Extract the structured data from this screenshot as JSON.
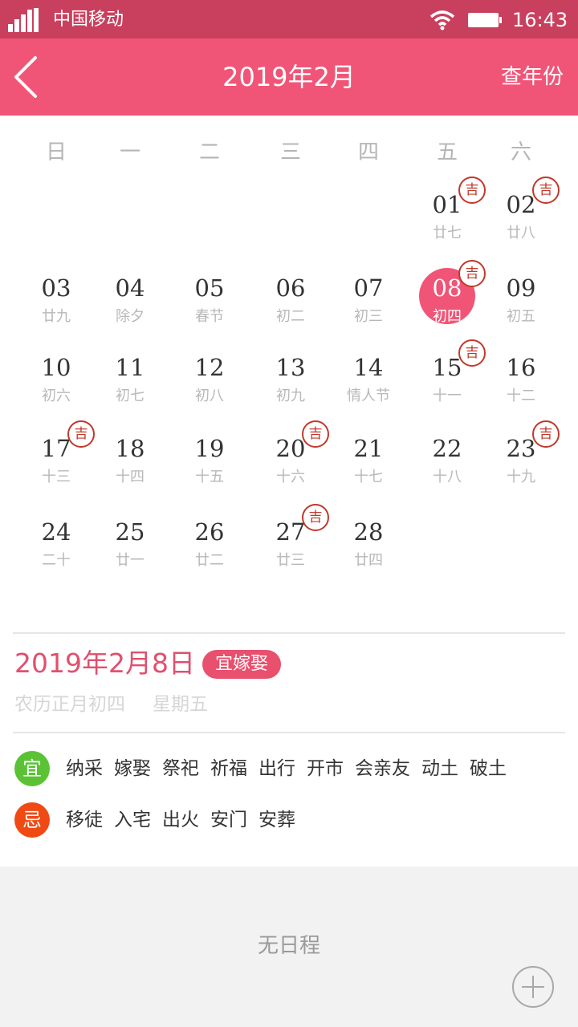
{
  "status_bar": {
    "carrier": "中国移动",
    "time": "16:43",
    "signal_icon": "signal-bars-icon",
    "wifi_icon": "wifi-icon",
    "battery_icon": "battery-icon"
  },
  "header": {
    "title": "2019年2月",
    "year_button": "查年份",
    "back_icon": "chevron-left-icon"
  },
  "weekdays": [
    "日",
    "一",
    "二",
    "三",
    "四",
    "五",
    "六"
  ],
  "days": [
    {
      "num": "01",
      "lunar": "廿七",
      "col": 5,
      "row": 0,
      "ji": true
    },
    {
      "num": "02",
      "lunar": "廿八",
      "col": 6,
      "row": 0,
      "ji": true
    },
    {
      "num": "03",
      "lunar": "廿九",
      "col": 0,
      "row": 1
    },
    {
      "num": "04",
      "lunar": "除夕",
      "col": 1,
      "row": 1
    },
    {
      "num": "05",
      "lunar": "春节",
      "col": 2,
      "row": 1
    },
    {
      "num": "06",
      "lunar": "初二",
      "col": 3,
      "row": 1
    },
    {
      "num": "07",
      "lunar": "初三",
      "col": 4,
      "row": 1
    },
    {
      "num": "08",
      "lunar": "初四",
      "col": 5,
      "row": 1,
      "ji": true,
      "selected": true
    },
    {
      "num": "09",
      "lunar": "初五",
      "col": 6,
      "row": 1
    },
    {
      "num": "10",
      "lunar": "初六",
      "col": 0,
      "row": 2
    },
    {
      "num": "11",
      "lunar": "初七",
      "col": 1,
      "row": 2
    },
    {
      "num": "12",
      "lunar": "初八",
      "col": 2,
      "row": 2
    },
    {
      "num": "13",
      "lunar": "初九",
      "col": 3,
      "row": 2
    },
    {
      "num": "14",
      "lunar": "情人节",
      "col": 4,
      "row": 2
    },
    {
      "num": "15",
      "lunar": "十一",
      "col": 5,
      "row": 2,
      "ji": true
    },
    {
      "num": "16",
      "lunar": "十二",
      "col": 6,
      "row": 2
    },
    {
      "num": "17",
      "lunar": "十三",
      "col": 0,
      "row": 3,
      "ji": true
    },
    {
      "num": "18",
      "lunar": "十四",
      "col": 1,
      "row": 3
    },
    {
      "num": "19",
      "lunar": "十五",
      "col": 2,
      "row": 3
    },
    {
      "num": "20",
      "lunar": "十六",
      "col": 3,
      "row": 3,
      "ji": true
    },
    {
      "num": "21",
      "lunar": "十七",
      "col": 4,
      "row": 3
    },
    {
      "num": "22",
      "lunar": "十八",
      "col": 5,
      "row": 3
    },
    {
      "num": "23",
      "lunar": "十九",
      "col": 6,
      "row": 3,
      "ji": true
    },
    {
      "num": "24",
      "lunar": "二十",
      "col": 0,
      "row": 4
    },
    {
      "num": "25",
      "lunar": "廿一",
      "col": 1,
      "row": 4
    },
    {
      "num": "26",
      "lunar": "廿二",
      "col": 2,
      "row": 4
    },
    {
      "num": "27",
      "lunar": "廿三",
      "col": 3,
      "row": 4,
      "ji": true
    },
    {
      "num": "28",
      "lunar": "廿四",
      "col": 4,
      "row": 4
    }
  ],
  "auspicious_badge": "吉",
  "detail": {
    "date": "2019年2月8日",
    "tag": "宜嫁娶",
    "lunar_date": "农历正月初四",
    "weekday": "星期五",
    "yi_label": "宜",
    "yi_items": [
      "纳采",
      "嫁娶",
      "祭祀",
      "祈福",
      "出行",
      "开市",
      "会亲友",
      "动土",
      "破土"
    ],
    "ji_label": "忌",
    "ji_items": [
      "移徒",
      "入宅",
      "出火",
      "安门",
      "安葬"
    ]
  },
  "schedule": {
    "empty_text": "无日程",
    "add_icon": "plus-circle-icon"
  },
  "colors": {
    "status_bar": "#c9405e",
    "header": "#f05577",
    "yi": "#5bc236",
    "ji": "#f04a14",
    "badge": "#c0392b"
  }
}
